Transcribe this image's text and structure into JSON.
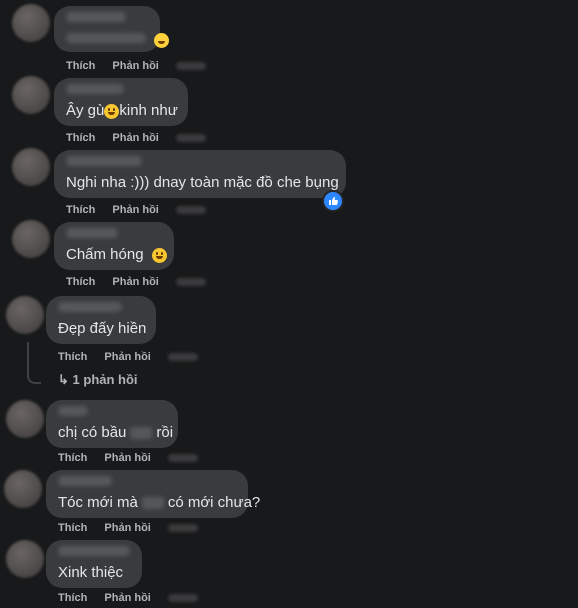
{
  "comments": [
    {
      "text_before": "",
      "text_after": "",
      "emoji": "laughing-emoji",
      "like": "Thích",
      "reply": "Phản hồi"
    },
    {
      "text_before": "Ây gù",
      "text_after": "kinh như",
      "emoji": "grinning-emoji",
      "like": "Thích",
      "reply": "Phản hồi"
    },
    {
      "text": "Nghi nha :))) dnay toàn mặc đồ che bụng",
      "like": "Thích",
      "reply": "Phản hồi",
      "reaction": "like-reaction"
    },
    {
      "text": "Chấm hóng",
      "emoji": "smile-emoji",
      "like": "Thích",
      "reply": "Phản hồi"
    },
    {
      "text": "Đẹp đấy hiền",
      "like": "Thích",
      "reply": "Phản hồi",
      "replies_label": "1 phản hồi"
    },
    {
      "text_before": "chị có bầu",
      "text_after": "rồi",
      "like": "Thích",
      "reply": "Phản hồi"
    },
    {
      "text_before": "Tóc mới mà",
      "text_after": "có mới chưa?",
      "like": "Thích",
      "reply": "Phản hồi"
    },
    {
      "text": "Xink thiệc",
      "like": "Thích",
      "reply": "Phản hồi"
    }
  ],
  "colors": {
    "background": "#18191a",
    "bubble": "#3a3b3c",
    "text": "#e4e6eb",
    "muted": "#b0b3b8",
    "like_blue": "#2d88ff"
  }
}
